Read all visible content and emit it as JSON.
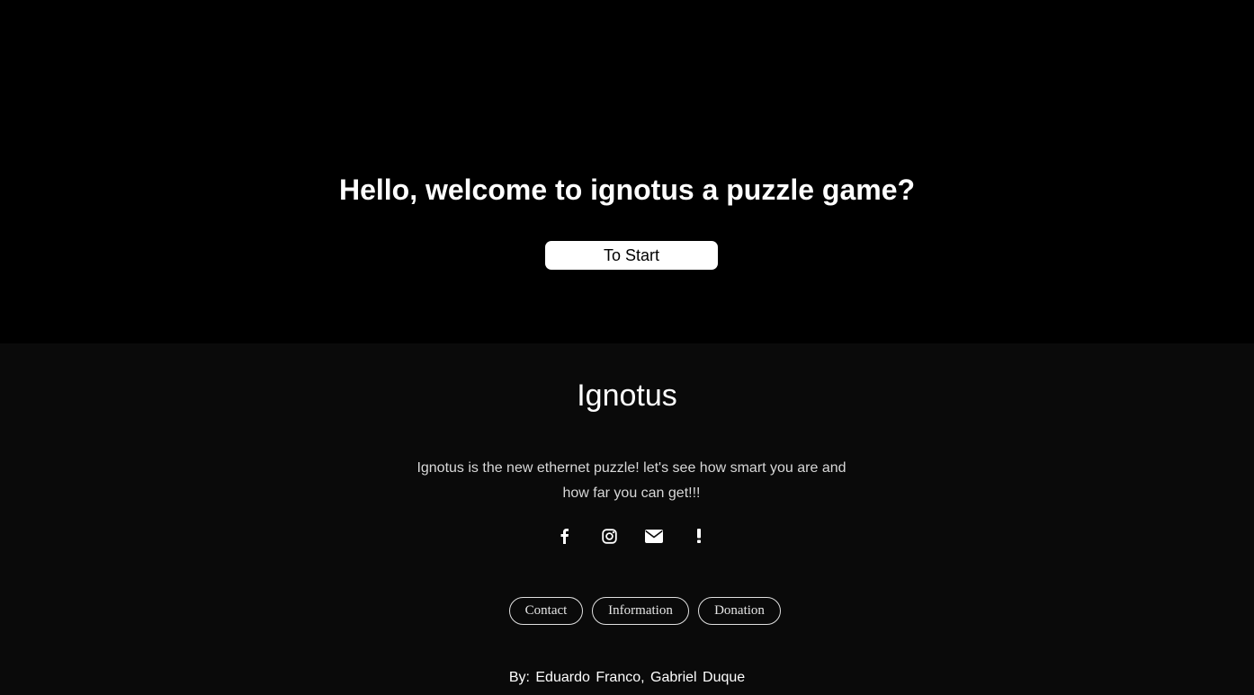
{
  "hero": {
    "title": "Hello, welcome to ignotus a puzzle game?",
    "start_label": "To Start"
  },
  "footer": {
    "title": "Ignotus",
    "description": "Ignotus is the new ethernet puzzle! let's see how smart you are and how far you can get!!!",
    "social": [
      {
        "icon": "facebook-icon"
      },
      {
        "icon": "instagram-icon"
      },
      {
        "icon": "envelope-icon"
      },
      {
        "icon": "exclamation-icon"
      }
    ],
    "links": [
      {
        "label": "Contact"
      },
      {
        "label": "Information"
      },
      {
        "label": "Donation"
      }
    ],
    "credits": "By: Eduardo Franco, Gabriel Duque"
  },
  "colors": {
    "hero_bg": "#000000",
    "footer_bg": "#0a0a0a",
    "text": "#ffffff",
    "button_bg": "#ffffff"
  }
}
